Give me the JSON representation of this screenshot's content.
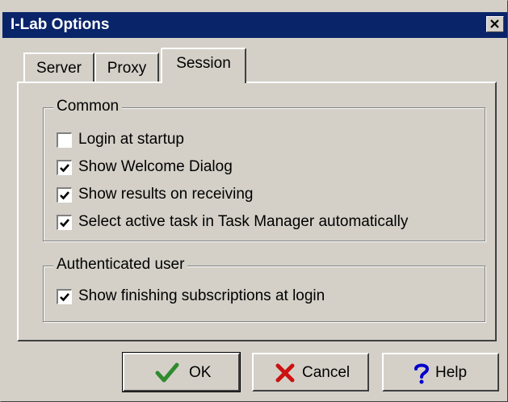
{
  "window": {
    "title": "I-Lab Options"
  },
  "tabs": [
    {
      "label": "Server",
      "active": false
    },
    {
      "label": "Proxy",
      "active": false
    },
    {
      "label": "Session",
      "active": true
    }
  ],
  "groups": {
    "common": {
      "label": "Common",
      "options": [
        {
          "label": "Login at startup",
          "checked": false
        },
        {
          "label": "Show Welcome Dialog",
          "checked": true
        },
        {
          "label": "Show results on receiving",
          "checked": true
        },
        {
          "label": "Select active task in Task Manager automatically",
          "checked": true
        }
      ]
    },
    "authenticated": {
      "label": "Authenticated user",
      "options": [
        {
          "label": "Show finishing subscriptions at login",
          "checked": true
        }
      ]
    }
  },
  "buttons": {
    "ok": "OK",
    "cancel": "Cancel",
    "help": "Help"
  },
  "icons": {
    "close": "close-icon",
    "ok": "check-icon",
    "cancel": "x-icon",
    "help": "question-icon"
  },
  "colors": {
    "titlebar": "#0a246a",
    "face": "#d4d0c8",
    "ok_icon": "#2e8b2e",
    "cancel_icon": "#cc1111",
    "help_icon": "#0000cc"
  }
}
